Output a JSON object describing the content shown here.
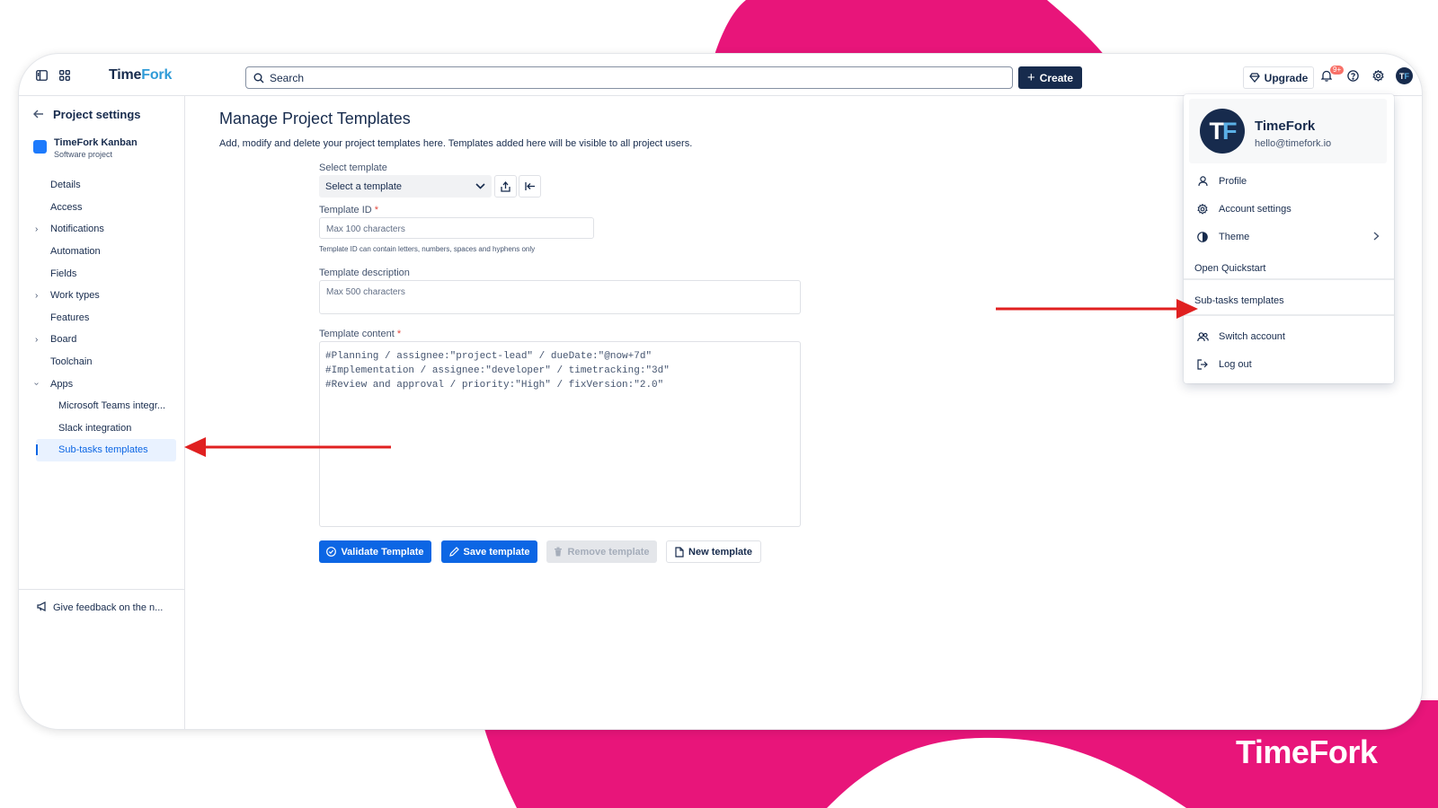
{
  "app": {
    "logo_part1": "Time",
    "logo_part2": "Fork"
  },
  "topbar": {
    "search_label": "Search",
    "create_label": "Create",
    "upgrade_label": "Upgrade",
    "notif_count": "9+",
    "avatar_initial_1": "T",
    "avatar_initial_2": "F"
  },
  "sidebar": {
    "header": "Project settings",
    "project_name": "TimeFork Kanban",
    "project_type": "Software project",
    "items": [
      {
        "label": "Details"
      },
      {
        "label": "Access"
      },
      {
        "label": "Notifications"
      },
      {
        "label": "Automation"
      },
      {
        "label": "Fields"
      },
      {
        "label": "Work types"
      },
      {
        "label": "Features"
      },
      {
        "label": "Board"
      },
      {
        "label": "Toolchain"
      },
      {
        "label": "Apps"
      }
    ],
    "apps": [
      {
        "label": "Microsoft Teams integr..."
      },
      {
        "label": "Slack integration"
      },
      {
        "label": "Sub-tasks templates"
      }
    ],
    "feedback": "Give feedback on the n..."
  },
  "main": {
    "title": "Manage Project Templates",
    "description": "Add, modify and delete your project templates here. Templates added here will be visible to all project users.",
    "select_label": "Select template",
    "select_value": "Select a template",
    "id_label": "Template ID",
    "id_placeholder": "Max 100 characters",
    "id_hint": "Template ID can contain letters, numbers, spaces and hyphens only",
    "desc_label": "Template description",
    "desc_placeholder": "Max 500 characters",
    "content_label": "Template content",
    "required_mark": "*",
    "content_lines": [
      "#Planning / assignee:\"project-lead\" / dueDate:\"@now+7d\"",
      "#Implementation / assignee:\"developer\" / timetracking:\"3d\"",
      "#Review and approval / priority:\"High\" / fixVersion:\"2.0\""
    ],
    "buttons": {
      "validate": "Validate Template",
      "save": "Save template",
      "remove": "Remove template",
      "new": "New template"
    }
  },
  "menu": {
    "name": "TimeFork",
    "email": "hello@timefork.io",
    "avatar_1": "T",
    "avatar_2": "F",
    "items": {
      "profile": "Profile",
      "account_settings": "Account settings",
      "theme": "Theme",
      "quickstart": "Open Quickstart",
      "subtasks": "Sub-tasks templates",
      "switch": "Switch account",
      "logout": "Log out"
    }
  },
  "brand": "TimeFork",
  "colors": {
    "accent": "#e8157a",
    "primary": "#0c66e4",
    "dark": "#172b4d",
    "arrow": "#e02020"
  }
}
